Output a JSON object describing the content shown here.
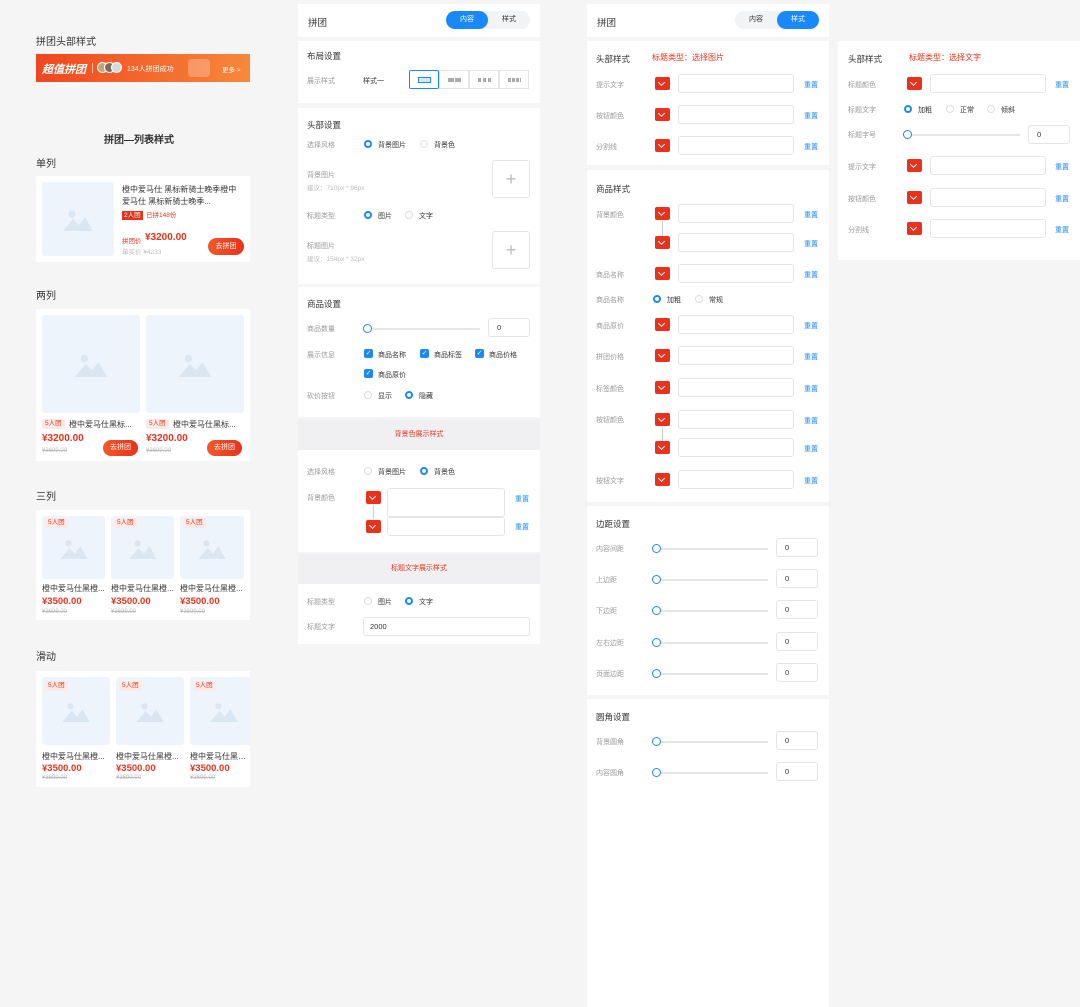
{
  "preview": {
    "header_title": "拼团头部样式",
    "banner": {
      "brand": "超值拼团",
      "text": "134人拼团成功",
      "more": "更多 >"
    },
    "list_title": "拼团—列表样式",
    "sections": {
      "single": "单列",
      "double": "两列",
      "triple": "三列",
      "slide": "滑动"
    },
    "single_item": {
      "name_line1": "橙中爱马仕 黑标新骑士晚季橙中",
      "name_line2": "爱马仕 黑标新骑士晚季...",
      "tag_count": "2人团",
      "tag_done": "已拼148份",
      "price_label": "拼团价",
      "price": "¥3200.00",
      "orig": "单买价 ¥4233",
      "button": "去拼团"
    },
    "double_items": [
      {
        "tag": "5人团",
        "name": "橙中爱马仕黑标...",
        "price": "¥3200.00",
        "orig": "¥3699.00",
        "button": "去拼团"
      },
      {
        "tag": "5人团",
        "name": "橙中爱马仕黑标...",
        "price": "¥3200.00",
        "orig": "¥3699.00",
        "button": "去拼团"
      }
    ],
    "triple_items": [
      {
        "tag": "5人团",
        "name": "橙中爱马仕黑橙...",
        "price": "¥3500.00",
        "orig": "¥3699.00"
      },
      {
        "tag": "5人团",
        "name": "橙中爱马仕黑橙...",
        "price": "¥3500.00",
        "orig": "¥3699.00"
      },
      {
        "tag": "5人团",
        "name": "橙中爱马仕黑橙...",
        "price": "¥3500.00",
        "orig": "¥3699.00"
      }
    ],
    "slide_items": [
      {
        "tag": "5人团",
        "name": "橙中爱马仕黑橙...",
        "price": "¥3500.00",
        "orig": "¥3699.00"
      },
      {
        "tag": "5人团",
        "name": "橙中爱马仕黑橙...",
        "price": "¥3500.00",
        "orig": "¥3699.00"
      },
      {
        "tag": "5人团",
        "name": "橙中爱马仕黑橙...",
        "price": "¥3500.00",
        "orig": "¥3699.00"
      }
    ]
  },
  "content_panel": {
    "title": "拼团",
    "tabs": {
      "content": "内容",
      "style": "样式",
      "active": "content"
    },
    "layout": {
      "title": "布局设置",
      "label": "展示样式",
      "value": "样式一"
    },
    "head": {
      "title": "头部设置",
      "style_label": "选择风格",
      "opt_bg_image": "背景图片",
      "opt_bg_color": "背景色",
      "bg_image_label": "背景图片",
      "bg_image_hint": "建议：710px * 96px",
      "title_type_label": "标题类型",
      "opt_image": "图片",
      "opt_text": "文字",
      "title_image_label": "标题图片",
      "title_image_hint": "建议：154px * 32px",
      "plus": "+"
    },
    "goods": {
      "title": "商品设置",
      "count_label": "商品数量",
      "count_value": "0",
      "info_label": "展示信息",
      "info_name": "商品名称",
      "info_tag": "商品标签",
      "info_price": "商品价格",
      "info_orig": "商品原价",
      "bargain_label": "砍价按钮",
      "opt_show": "显示",
      "opt_hide": "隐藏"
    },
    "bg_color_banner": "背景色展示样式",
    "bg_section": {
      "style_label": "选择风格",
      "opt_bg_image": "背景图片",
      "opt_bg_color": "背景色",
      "color_label": "背景颜色",
      "reset": "重置"
    },
    "text_banner": "标题文字展示样式",
    "text_section": {
      "title_type_label": "标题类型",
      "opt_image": "图片",
      "opt_text": "文字",
      "title_text_label": "标题文字",
      "title_text_value": "2000"
    }
  },
  "style_panel": {
    "title": "拼团",
    "tabs": {
      "content": "内容",
      "style": "样式",
      "active": "style"
    },
    "head": {
      "title": "头部样式",
      "note": "标题类型：选择图片",
      "rows": [
        "提示文字",
        "按钮颜色",
        "分割线"
      ],
      "reset": "重置"
    },
    "goods": {
      "title": "商品样式",
      "bg_label": "背景颜色",
      "name_label": "商品名称",
      "weight_label": "商品名称",
      "opt_bold": "加粗",
      "opt_normal": "常规",
      "orig_label": "商品原价",
      "group_price_label": "拼团价格",
      "tag_color_label": "标签颜色",
      "btn_color_label": "按钮颜色",
      "btn_text_label": "按钮文字",
      "reset": "重置"
    },
    "margin": {
      "title": "边距设置",
      "rows": [
        {
          "label": "内容间距",
          "value": "0"
        },
        {
          "label": "上边距",
          "value": "0"
        },
        {
          "label": "下边距",
          "value": "0"
        },
        {
          "label": "左右边距",
          "value": "0"
        },
        {
          "label": "页面边距",
          "value": "0"
        }
      ]
    },
    "radius": {
      "title": "圆角设置",
      "rows": [
        {
          "label": "背景圆角",
          "value": "0"
        },
        {
          "label": "内容圆角",
          "value": "0"
        }
      ]
    }
  },
  "text_style_panel": {
    "title": "头部样式",
    "note": "标题类型：选择文字",
    "title_color_label": "标题颜色",
    "title_text_label": "标题文字",
    "opt_bold": "加粗",
    "opt_normal": "正常",
    "opt_italic": "倾斜",
    "font_size_label": "标题字号",
    "font_size_value": "0",
    "hint_label": "提示文字",
    "btn_color_label": "按钮颜色",
    "divider_label": "分割线",
    "reset": "重置"
  },
  "colors": {
    "accent": "#1989fa",
    "brand_red": "#e8321b",
    "banner_orange": "#f36b2b"
  }
}
